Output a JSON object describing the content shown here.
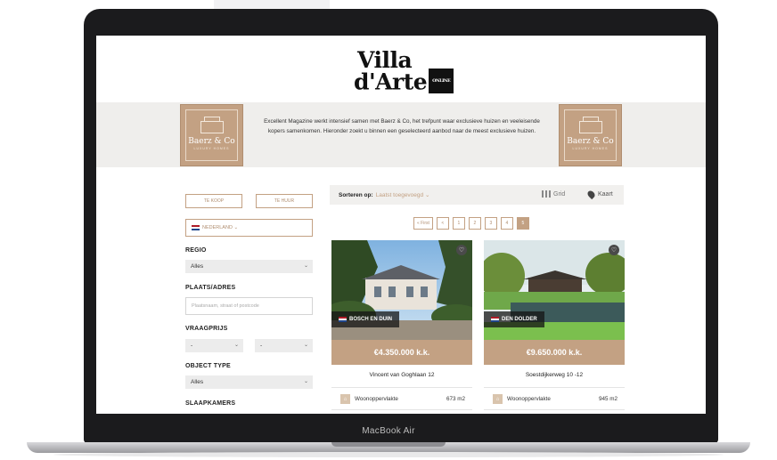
{
  "device": {
    "caption": "MacBook Air"
  },
  "site": {
    "logo": {
      "line1": "Villa",
      "line2": "d'Arte",
      "badge": "ONLINE"
    },
    "banner": {
      "text": "Excellent Magazine werkt intensief samen met Baerz & Co, het trefpunt waar exclusieve huizen en veeleisende kopers samenkomen. Hieronder zoekt u binnen een geselecteerd aanbod naar de meest exclusieve huizen.",
      "brand_name": "Baerz & Co",
      "brand_sub": "LUXURY HOMES"
    }
  },
  "sidebar": {
    "buy_label": "TE KOOP",
    "rent_label": "TE HUUR",
    "country": "NEDERLAND",
    "region_label": "REGIO",
    "region_value": "Alles",
    "place_label": "PLAATS/ADRES",
    "place_placeholder": "Plaatsnaam, straat of postcode",
    "price_label": "VRAAGPRIJS",
    "price_min": "-",
    "price_max": "-",
    "type_label": "OBJECT TYPE",
    "type_value": "Alles",
    "bedrooms_label": "SLAAPKAMERS"
  },
  "results": {
    "sort_label": "Sorteren op:",
    "sort_value": "Laatst toegevoegd",
    "grid_label": "Grid",
    "map_label": "Kaart",
    "pager": [
      "« First",
      "<",
      "1",
      "2",
      "3",
      "4",
      "5"
    ],
    "active_page": "5",
    "cards": [
      {
        "location": "BOSCH EN DUIN",
        "price": "€4.350.000 k.k.",
        "address": "Vincent van Goghlaan 12",
        "spec_label": "Woonoppervlakte",
        "spec_value": "673 m2"
      },
      {
        "location": "DEN DOLDER",
        "price": "€9.650.000 k.k.",
        "address": "Soestdijkerweg 10 -12",
        "spec_label": "Woonoppervlakte",
        "spec_value": "945 m2"
      }
    ]
  },
  "colors": {
    "accent": "#c3a183",
    "banner_bg": "#efeeec",
    "frame": "#1b1b1d"
  }
}
